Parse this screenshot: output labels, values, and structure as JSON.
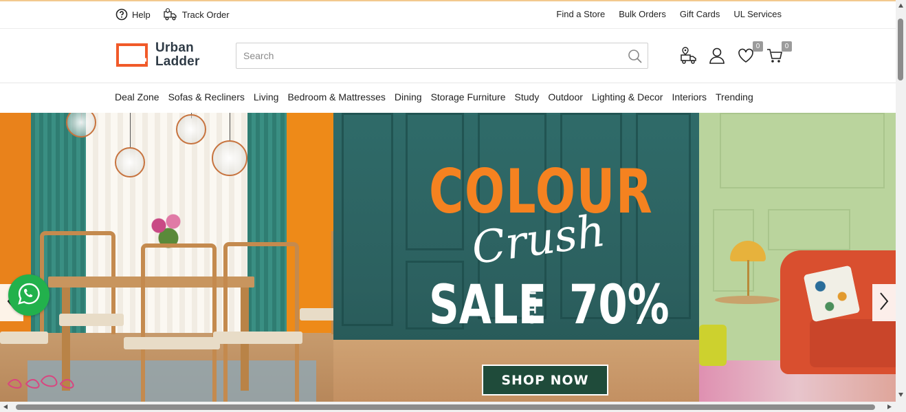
{
  "utility_bar": {
    "help_label": "Help",
    "track_order_label": "Track Order",
    "find_store_label": "Find a Store",
    "bulk_orders_label": "Bulk Orders",
    "gift_cards_label": "Gift Cards",
    "ul_services_label": "UL Services"
  },
  "header": {
    "logo_line1": "Urban",
    "logo_line2": "Ladder",
    "search_placeholder": "Search",
    "search_value": "",
    "wishlist_count": "0",
    "cart_count": "0",
    "icons": [
      "store-locator-icon",
      "user-icon",
      "wishlist-heart-icon",
      "cart-icon"
    ]
  },
  "nav": {
    "items": [
      "Deal Zone",
      "Sofas & Recliners",
      "Living",
      "Bedroom & Mattresses",
      "Dining",
      "Storage Furniture",
      "Study",
      "Outdoor",
      "Lighting & Decor",
      "Interiors",
      "Trending"
    ]
  },
  "hero": {
    "headline": "COLOUR",
    "script_text": "Crush",
    "sale_text": "SALE",
    "upto_text": "UPTO",
    "discount_text": "70%",
    "cta_label": "SHOP NOW"
  },
  "colors": {
    "brand_orange": "#f58220",
    "cta_green": "#1f4b3a",
    "whatsapp_green": "#22b14c"
  }
}
